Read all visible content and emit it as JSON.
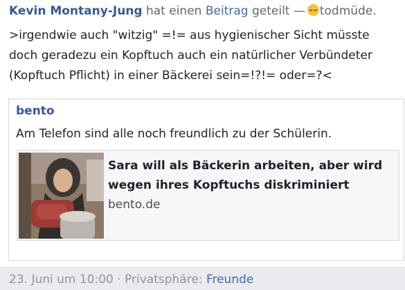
{
  "header": {
    "author": "Kevin Montany-Jung",
    "verb": "hat einen",
    "object_link": "Beitrag",
    "action": "geteilt —",
    "feeling_icon": "sleepy-face-icon",
    "feeling": "todmüde."
  },
  "post": {
    "lines": [
      ">irgendwie auch \"witzig\" =!= aus hygienischer Sicht müsste",
      "doch geradezu ein Kopftuch auch ein natürlicher Verbündeter",
      "(Kopftuch Pflicht)  in einer Bäckerei sein=!?!=  oder=?<"
    ]
  },
  "shared": {
    "source": "bento",
    "text": "Am Telefon sind alle noch freundlich zu der Schülerin.",
    "preview": {
      "title_lines": [
        "Sara will als Bäckerin arbeiten, aber wird",
        "wegen ihres Kopftuchs diskriminiert"
      ],
      "domain": "bento.de"
    }
  },
  "footer": {
    "date": "23. Juni um 10:00",
    "separator": "·",
    "privacy_label": "Privatsphäre:",
    "privacy_value": "Freunde"
  },
  "colors": {
    "link_blue": "#365899",
    "text": "#1d2129",
    "meta_gray": "#90949c",
    "card_border": "#d3d6db"
  }
}
